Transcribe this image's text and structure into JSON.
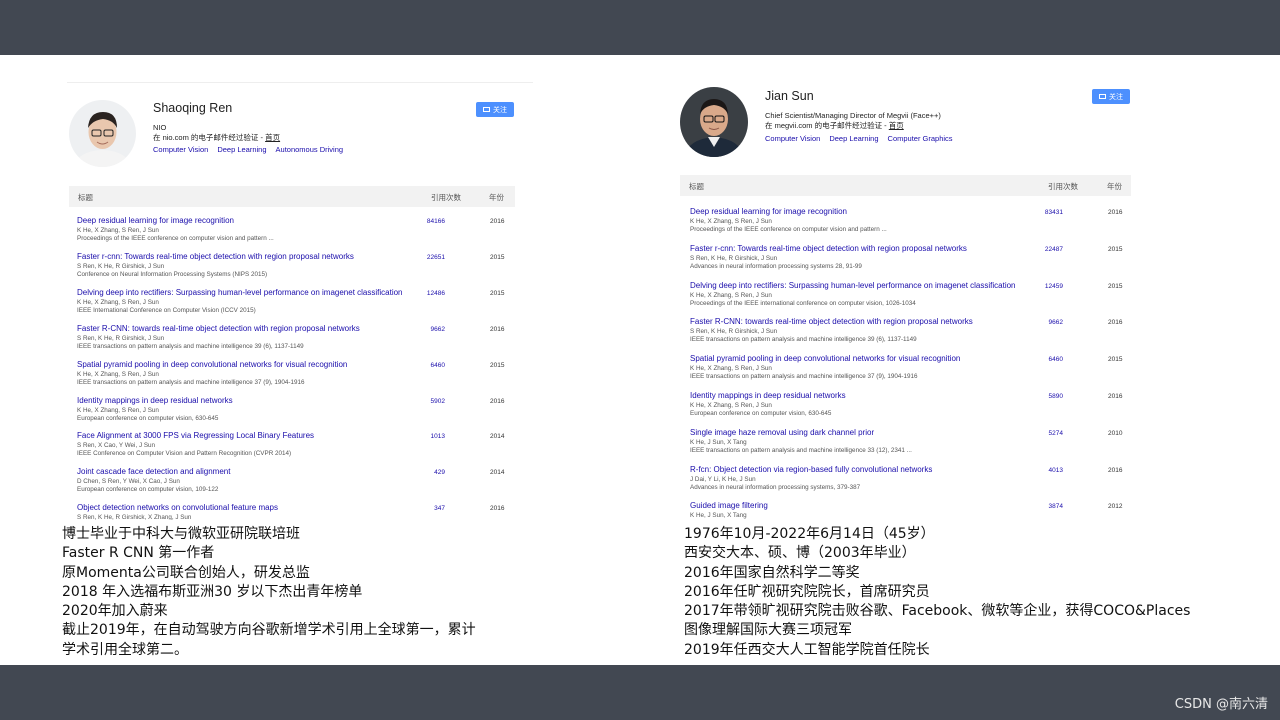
{
  "watermark": "CSDN @南六清",
  "left": {
    "name": "Shaoqing Ren",
    "affiliation": "NIO",
    "email_prefix": "在 nio.com 的电子邮件经过验证 - ",
    "homepage": "首页",
    "interests": [
      "Computer Vision",
      "Deep Learning",
      "Autonomous Driving"
    ],
    "follow_label": "关注",
    "headers": {
      "title": "标题",
      "cited": "引用次数",
      "year": "年份"
    },
    "rows": [
      {
        "title": "Deep residual learning for image recognition",
        "authors": "K He, X Zhang, S Ren, J Sun",
        "venue": "Proceedings of the IEEE conference on computer vision and pattern ...",
        "cited": "84166",
        "year": "2016"
      },
      {
        "title": "Faster r-cnn: Towards real-time object detection with region proposal networks",
        "authors": "S Ren, K He, R Girshick, J Sun",
        "venue": "Conference on Neural Information Processing Systems (NIPS 2015)",
        "cited": "22651",
        "year": "2015"
      },
      {
        "title": "Delving deep into rectifiers: Surpassing human-level performance on imagenet classification",
        "authors": "K He, X Zhang, S Ren, J Sun",
        "venue": "IEEE International Conference on Computer Vision (ICCV 2015)",
        "cited": "12486",
        "year": "2015"
      },
      {
        "title": "Faster R-CNN: towards real-time object detection with region proposal networks",
        "authors": "S Ren, K He, R Girshick, J Sun",
        "venue": "IEEE transactions on pattern analysis and machine intelligence 39 (6), 1137-1149",
        "cited": "9662",
        "year": "2016"
      },
      {
        "title": "Spatial pyramid pooling in deep convolutional networks for visual recognition",
        "authors": "K He, X Zhang, S Ren, J Sun",
        "venue": "IEEE transactions on pattern analysis and machine intelligence 37 (9), 1904-1916",
        "cited": "6460",
        "year": "2015"
      },
      {
        "title": "Identity mappings in deep residual networks",
        "authors": "K He, X Zhang, S Ren, J Sun",
        "venue": "European conference on computer vision, 630-645",
        "cited": "5902",
        "year": "2016"
      },
      {
        "title": "Face Alignment at 3000 FPS via Regressing Local Binary Features",
        "authors": "S Ren, X Cao, Y Wei, J Sun",
        "venue": "IEEE Conference on Computer Vision and Pattern Recognition (CVPR 2014)",
        "cited": "1013",
        "year": "2014"
      },
      {
        "title": "Joint cascade face detection and alignment",
        "authors": "D Chen, S Ren, Y Wei, X Cao, J Sun",
        "venue": "European conference on computer vision, 109-122",
        "cited": "429",
        "year": "2014"
      },
      {
        "title": "Object detection networks on convolutional feature maps",
        "authors": "S Ren, K He, R Girshick, X Zhang, J Sun",
        "venue": "",
        "cited": "347",
        "year": "2016"
      }
    ],
    "notes": [
      "博士毕业于中科大与微软亚研院联培班",
      "Faster R CNN 第一作者",
      "原Momenta公司联合创始人，研发总监",
      "2018 年入选福布斯亚洲30 岁以下杰出青年榜单",
      "2020年加入蔚来",
      "截止2019年，在自动驾驶方向谷歌新增学术引用上全球第一，累计",
      "学术引用全球第二。"
    ]
  },
  "right": {
    "name": "Jian Sun",
    "affiliation": "Chief Scientist/Managing Director of Megvii (Face++)",
    "email_prefix": "在 megvii.com 的电子邮件经过验证 - ",
    "homepage": "首页",
    "interests": [
      "Computer Vision",
      "Deep Learning",
      "Computer Graphics"
    ],
    "follow_label": "关注",
    "headers": {
      "title": "标题",
      "cited": "引用次数",
      "year": "年份"
    },
    "rows": [
      {
        "title": "Deep residual learning for image recognition",
        "authors": "K He, X Zhang, S Ren, J Sun",
        "venue": "Proceedings of the IEEE conference on computer vision and pattern ...",
        "cited": "83431",
        "year": "2016"
      },
      {
        "title": "Faster r-cnn: Towards real-time object detection with region proposal networks",
        "authors": "S Ren, K He, R Girshick, J Sun",
        "venue": "Advances in neural information processing systems 28, 91-99",
        "cited": "22487",
        "year": "2015"
      },
      {
        "title": "Delving deep into rectifiers: Surpassing human-level performance on imagenet classification",
        "authors": "K He, X Zhang, S Ren, J Sun",
        "venue": "Proceedings of the IEEE international conference on computer vision, 1026-1034",
        "cited": "12459",
        "year": "2015"
      },
      {
        "title": "Faster R-CNN: towards real-time object detection with region proposal networks",
        "authors": "S Ren, K He, R Girshick, J Sun",
        "venue": "IEEE transactions on pattern analysis and machine intelligence 39 (6), 1137-1149",
        "cited": "9662",
        "year": "2016"
      },
      {
        "title": "Spatial pyramid pooling in deep convolutional networks for visual recognition",
        "authors": "K He, X Zhang, S Ren, J Sun",
        "venue": "IEEE transactions on pattern analysis and machine intelligence 37 (9), 1904-1916",
        "cited": "6460",
        "year": "2015"
      },
      {
        "title": "Identity mappings in deep residual networks",
        "authors": "K He, X Zhang, S Ren, J Sun",
        "venue": "European conference on computer vision, 630-645",
        "cited": "5890",
        "year": "2016"
      },
      {
        "title": "Single image haze removal using dark channel prior",
        "authors": "K He, J Sun, X Tang",
        "venue": "IEEE transactions on pattern analysis and machine intelligence 33 (12), 2341 ...",
        "cited": "5274",
        "year": "2010"
      },
      {
        "title": "R-fcn: Object detection via region-based fully convolutional networks",
        "authors": "J Dai, Y Li, K He, J Sun",
        "venue": "Advances in neural information processing systems, 379-387",
        "cited": "4013",
        "year": "2016"
      },
      {
        "title": "Guided image filtering",
        "authors": "K He, J Sun, X Tang",
        "venue": "",
        "cited": "3874",
        "year": "2012"
      }
    ],
    "notes": [
      "1976年10月-2022年6月14日（45岁）",
      "西安交大本、硕、博（2003年毕业）",
      "2016年国家自然科学二等奖",
      "2016年任旷视研究院院长，首席研究员",
      "2017年带领旷视研究院击败谷歌、Facebook、微软等企业，获得COCO&Places",
      "图像理解国际大赛三项冠军",
      "2019年任西交大人工智能学院首任院长"
    ]
  }
}
